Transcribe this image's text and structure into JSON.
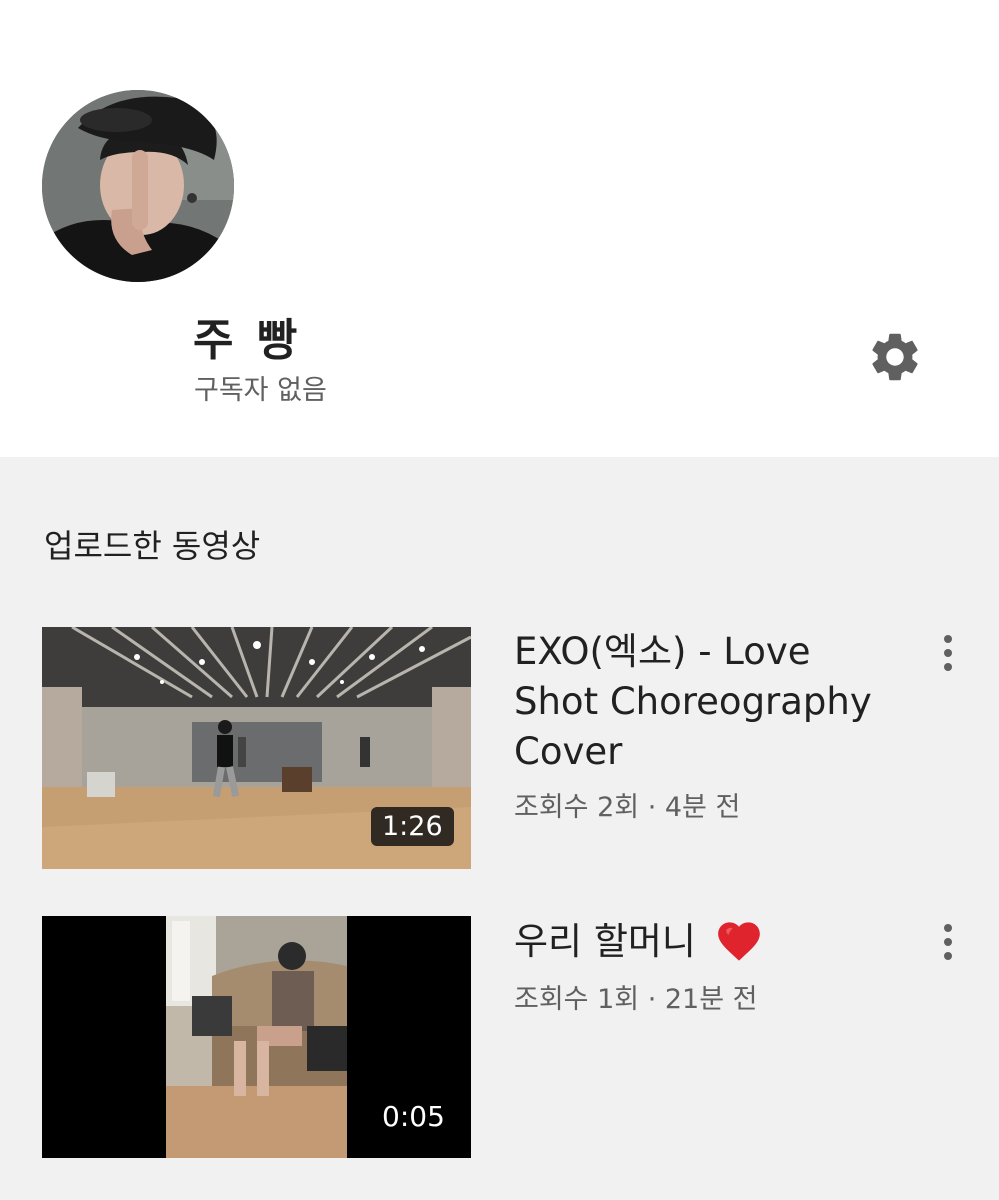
{
  "channel": {
    "name": "주 빵",
    "subscribers": "구독자 없음"
  },
  "icons": {
    "avatar": "profile-photo",
    "settings": "gear-icon",
    "more": "more-vertical-icon",
    "heart": "red-heart-emoji"
  },
  "section": {
    "title": "업로드한 동영상"
  },
  "videos": [
    {
      "title": "EXO(엑소) - Love Shot Choreography Cover",
      "meta": "조회수 2회 · 4분 전",
      "duration": "1:26"
    },
    {
      "title": "우리 할머니",
      "meta": "조회수 1회 · 21분 전",
      "duration": "0:05"
    }
  ],
  "colors": {
    "background_top": "#ffffff",
    "background_list": "#f1f1f1",
    "text_primary": "#212121",
    "text_secondary": "#606060",
    "heart": "#e0242e"
  }
}
